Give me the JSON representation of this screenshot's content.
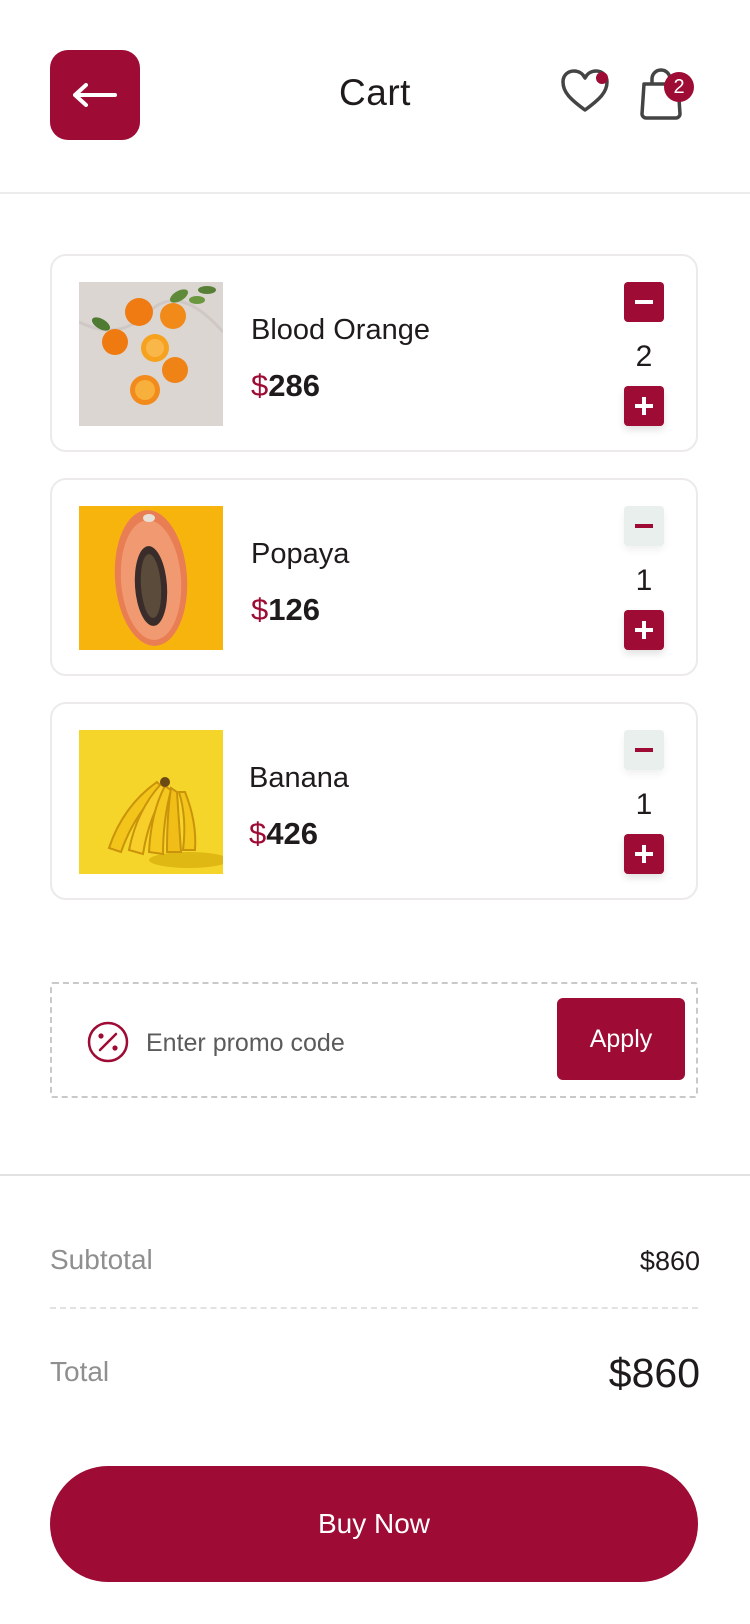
{
  "header": {
    "title": "Cart",
    "back_icon": "arrow-left-icon",
    "wishlist_icon": "heart-icon",
    "cart_icon": "shopping-bag-icon",
    "cart_badge": "2"
  },
  "cart": {
    "items": [
      {
        "name": "Blood Orange",
        "currency": "$",
        "price": "286",
        "quantity": "2"
      },
      {
        "name": "Popaya",
        "currency": "$",
        "price": "126",
        "quantity": "1"
      },
      {
        "name": "Banana",
        "currency": "$",
        "price": "426",
        "quantity": "1"
      }
    ]
  },
  "promo": {
    "icon": "percent-badge-icon",
    "placeholder": "Enter promo code",
    "apply_label": "Apply"
  },
  "summary": {
    "subtotal_label": "Subtotal",
    "subtotal_value": "$860",
    "total_label": "Total",
    "total_value": "$860"
  },
  "checkout": {
    "buy_label": "Buy Now"
  },
  "colors": {
    "accent": "#9e0b34",
    "muted_button": "#e8efec",
    "text": "#1f1a1c",
    "secondary_text": "#8f8f8f"
  }
}
